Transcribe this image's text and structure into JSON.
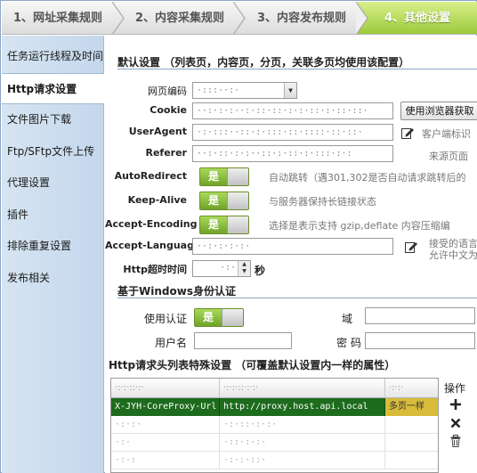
{
  "wizard": {
    "steps": [
      {
        "label": "1、网址采集规则"
      },
      {
        "label": "2、内容采集规则"
      },
      {
        "label": "3、内容发布规则"
      },
      {
        "label": "4、其他设置"
      }
    ]
  },
  "sidebar": {
    "items": [
      {
        "label": "任务运行线程及时间"
      },
      {
        "label": "Http请求设置"
      },
      {
        "label": "文件图片下载"
      },
      {
        "label": "Ftp/SFtp文件上传"
      },
      {
        "label": "代理设置"
      },
      {
        "label": "插件"
      },
      {
        "label": "排除重复设置"
      },
      {
        "label": "发布相关"
      }
    ]
  },
  "main": {
    "default_section_title": "默认设置 （列表页，内容页，分页，关联多页均使用该配置）",
    "encoding": {
      "label": "网页编码",
      "value": "·:::··:·"
    },
    "cookie": {
      "label": "Cookie",
      "value": "··:·:·:··:·::·::·:·:·::·:·::·::·",
      "button": "使用浏览器获取"
    },
    "useragent": {
      "label": "UserAgent",
      "value": "·:·:::··::·:·:::·::·::::·::·::·",
      "hint": "客户端标识"
    },
    "referer": {
      "label": "Referer",
      "value": "··:·::·:·:··::·:·::·:·:::·:·:",
      "hint": "来源页面"
    },
    "autoredirect": {
      "label": "AutoRedirect",
      "state": "是",
      "hint": "自动跳转（遇301,302是否自动请求跳转后的"
    },
    "keepalive": {
      "label": "Keep-Alive",
      "state": "是",
      "hint": "与服务器保持长链接状态"
    },
    "acceptencoding": {
      "label": "Accept-Encoding",
      "state": "是",
      "hint": "选择是表示支持 gzip,deflate 内容压缩编"
    },
    "acceptlanguage": {
      "label": "Accept-Language",
      "value": "··:·:·:·:·",
      "hint_line1": "接受的语言",
      "hint_line2": "允许中文为"
    },
    "timeout": {
      "label": "Http超时时间",
      "value": "·:·",
      "unit": "秒"
    },
    "auth_section_title": "基于Windows身份认证",
    "auth": {
      "use_label": "使用认证",
      "use_state": "是",
      "domain_label": "域",
      "username_label": "用户名",
      "password_label": "密  码"
    },
    "headers_section_title": "Http请求头列表特殊设置 （可覆盖默认设置内一样的属性）",
    "grid": {
      "columns": [
        "·:·:·::·:·",
        "·:·:·::·:·:·",
        "·:·:·"
      ],
      "rows": [
        {
          "c1": "X-JYH-CoreProxy-Url",
          "c2": "http://proxy.host.api.local",
          "c3": "多页一样",
          "selected": true
        },
        {
          "c1": "·:·:·",
          "c2": "·:·::·:·:·",
          "c3": "",
          "selected": false
        },
        {
          "c1": "·:·",
          "c2": "·::·:·:·",
          "c3": "",
          "selected": false
        },
        {
          "c1": "·:·:",
          "c2": "·:·:·::·",
          "c3": "",
          "selected": false
        }
      ]
    },
    "ops_title": "操作"
  },
  "colors": {
    "accent_green": "#7fb52f",
    "sidebar_bg": "#c9dbee",
    "selected_row": "#1d6b1d"
  }
}
